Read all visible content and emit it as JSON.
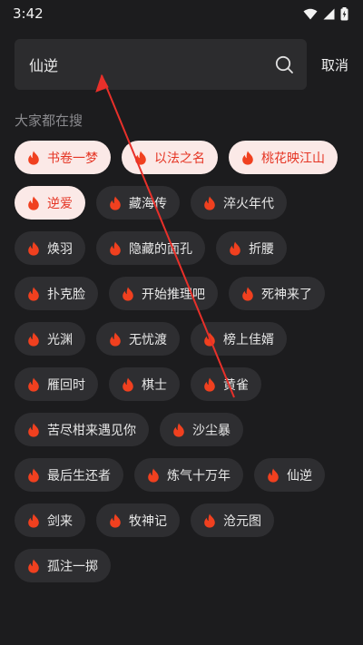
{
  "status_bar": {
    "time": "3:42"
  },
  "search": {
    "query": "仙逆",
    "cancel_label": "取消"
  },
  "section": {
    "title": "大家都在搜"
  },
  "tags": [
    {
      "label": "书卷一梦",
      "hot": true
    },
    {
      "label": "以法之名",
      "hot": true
    },
    {
      "label": "桃花映江山",
      "hot": true
    },
    {
      "label": "逆爱",
      "hot": true
    },
    {
      "label": "藏海传",
      "hot": false
    },
    {
      "label": "淬火年代",
      "hot": false
    },
    {
      "label": "焕羽",
      "hot": false
    },
    {
      "label": "隐藏的面孔",
      "hot": false
    },
    {
      "label": "折腰",
      "hot": false
    },
    {
      "label": "扑克脸",
      "hot": false
    },
    {
      "label": "开始推理吧",
      "hot": false
    },
    {
      "label": "死神来了",
      "hot": false
    },
    {
      "label": "光渊",
      "hot": false
    },
    {
      "label": "无忧渡",
      "hot": false
    },
    {
      "label": "榜上佳婿",
      "hot": false
    },
    {
      "label": "雁回时",
      "hot": false
    },
    {
      "label": "棋士",
      "hot": false
    },
    {
      "label": "黄雀",
      "hot": false
    },
    {
      "label": "苦尽柑来遇见你",
      "hot": false
    },
    {
      "label": "沙尘暴",
      "hot": false
    },
    {
      "label": "最后生还者",
      "hot": false
    },
    {
      "label": "炼气十万年",
      "hot": false
    },
    {
      "label": "仙逆",
      "hot": false
    },
    {
      "label": "剑来",
      "hot": false
    },
    {
      "label": "牧神记",
      "hot": false
    },
    {
      "label": "沧元图",
      "hot": false
    },
    {
      "label": "孤注一掷",
      "hot": false
    }
  ],
  "colors": {
    "hot_text": "#e53524",
    "hot_bg": "#fbe9e7",
    "flame": "#f0401f",
    "annotation": "#e8302a"
  },
  "icons": {
    "search": "search-icon",
    "tag": "flame-icon",
    "status": [
      "wifi-icon",
      "signal-icon",
      "battery-icon"
    ]
  }
}
